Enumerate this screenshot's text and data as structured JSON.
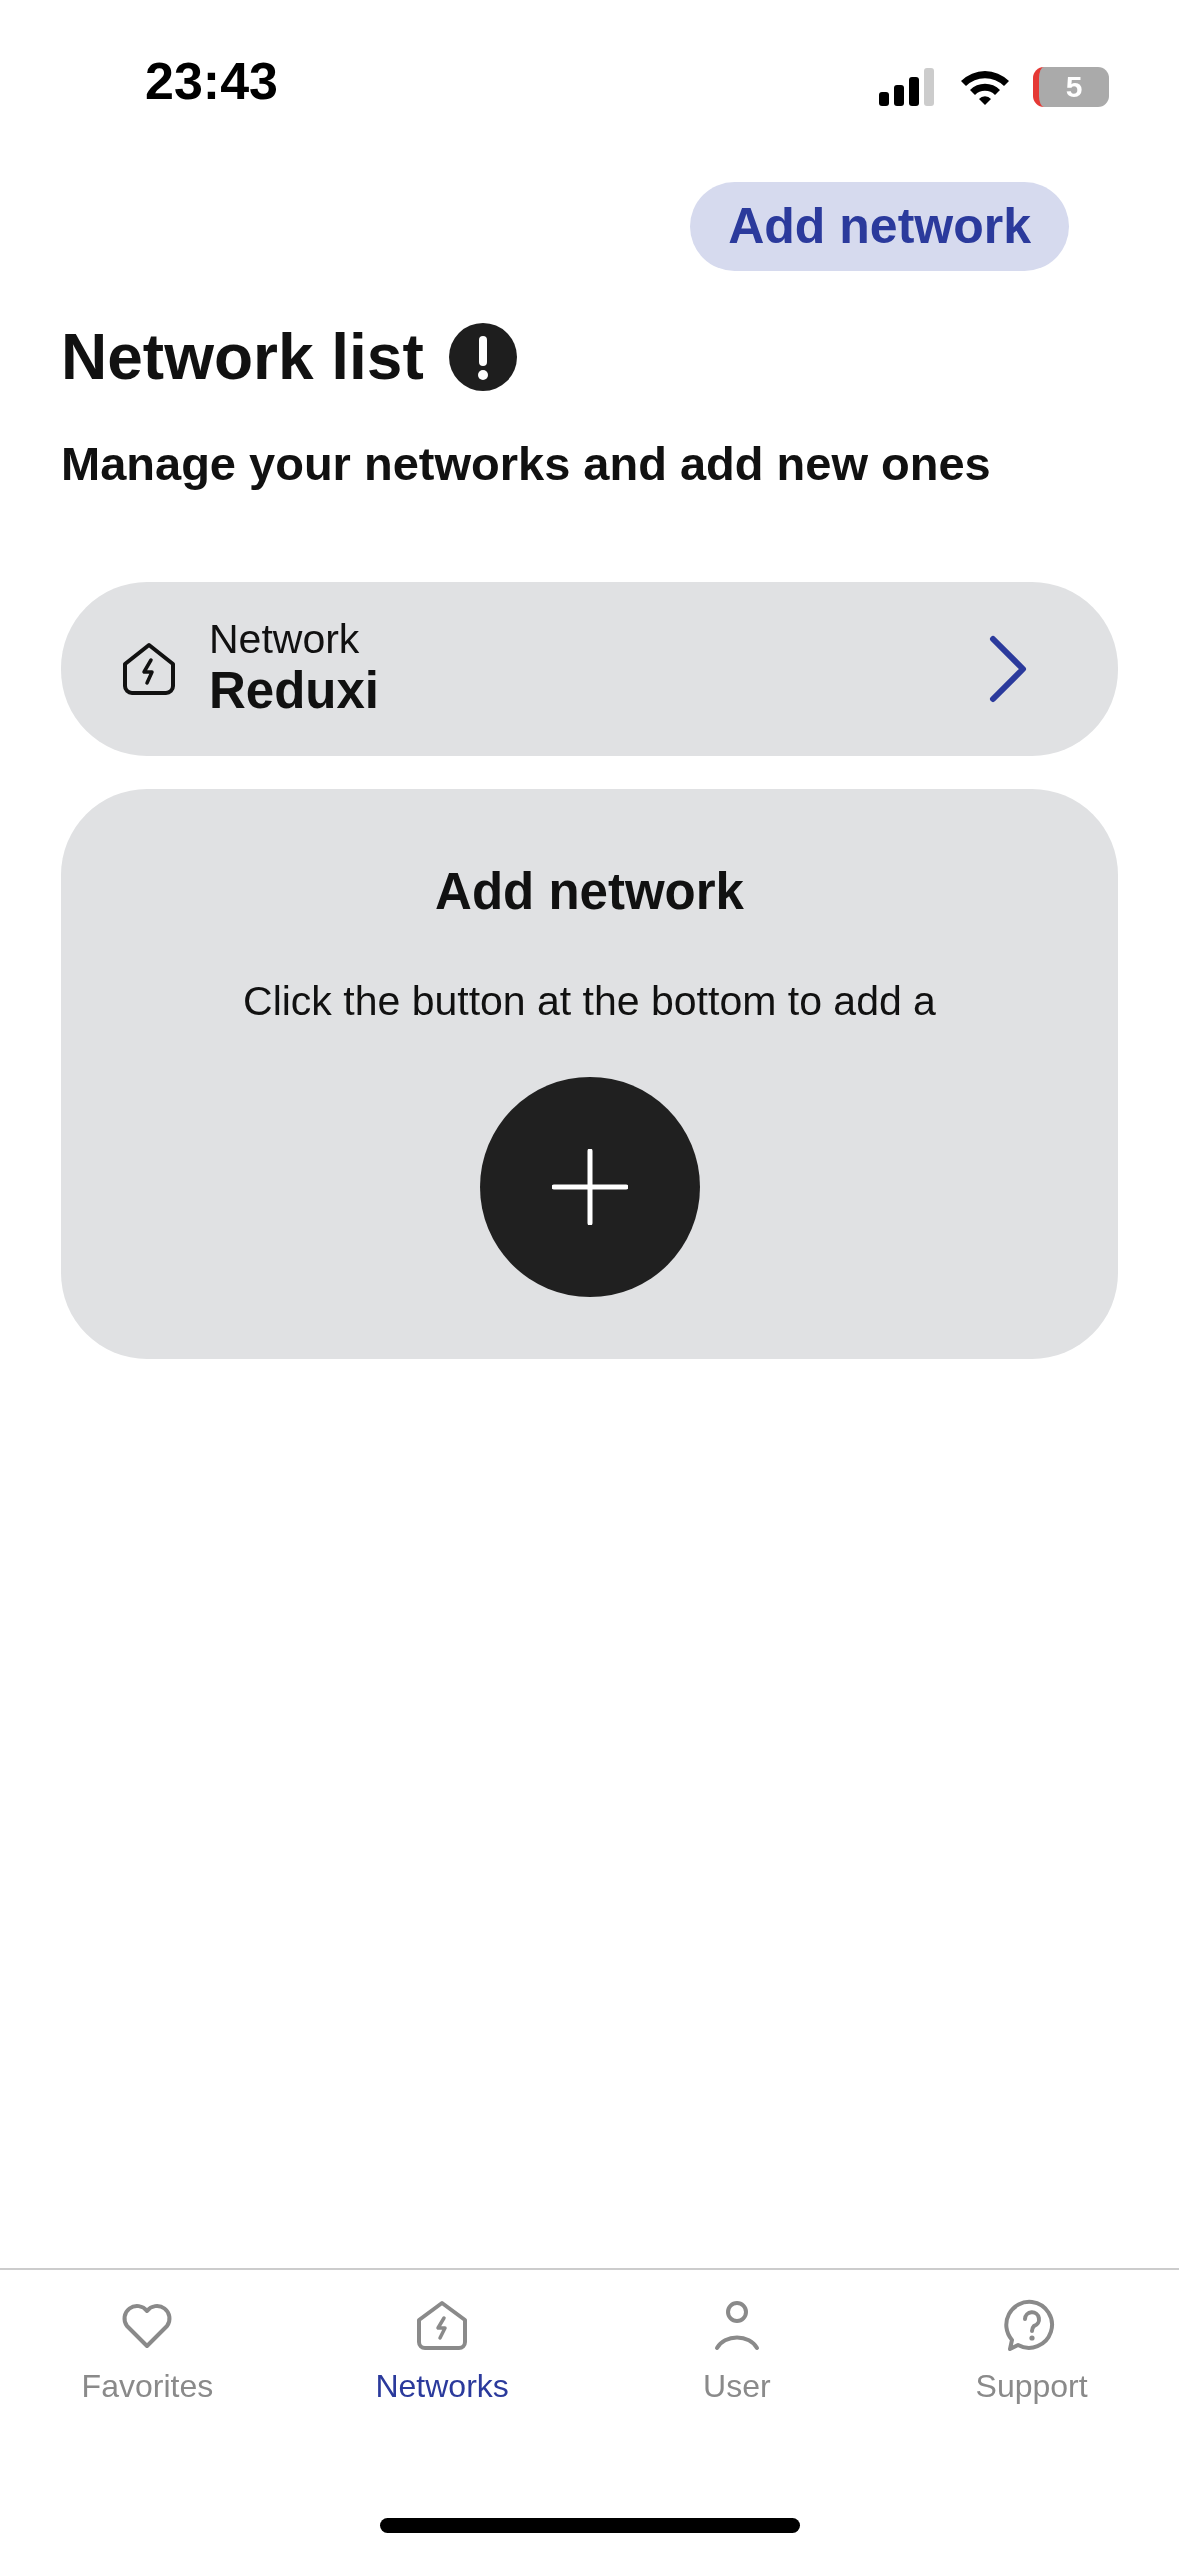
{
  "status_bar": {
    "time": "23:43",
    "battery": "5"
  },
  "header": {
    "action_button": "Add network"
  },
  "title": "Network list",
  "subtitle": "Manage your networks and add new ones",
  "networks": [
    {
      "label": "Network",
      "name": "Reduxi"
    }
  ],
  "add_card": {
    "title": "Add network",
    "text": "Click the button at the bottom to add a"
  },
  "tabs": [
    {
      "kind": "heart",
      "label": "Favorites",
      "selected": false
    },
    {
      "kind": "network",
      "label": "Networks",
      "selected": true
    },
    {
      "kind": "user",
      "label": "User",
      "selected": false
    },
    {
      "kind": "support",
      "label": "Support",
      "selected": false
    }
  ]
}
